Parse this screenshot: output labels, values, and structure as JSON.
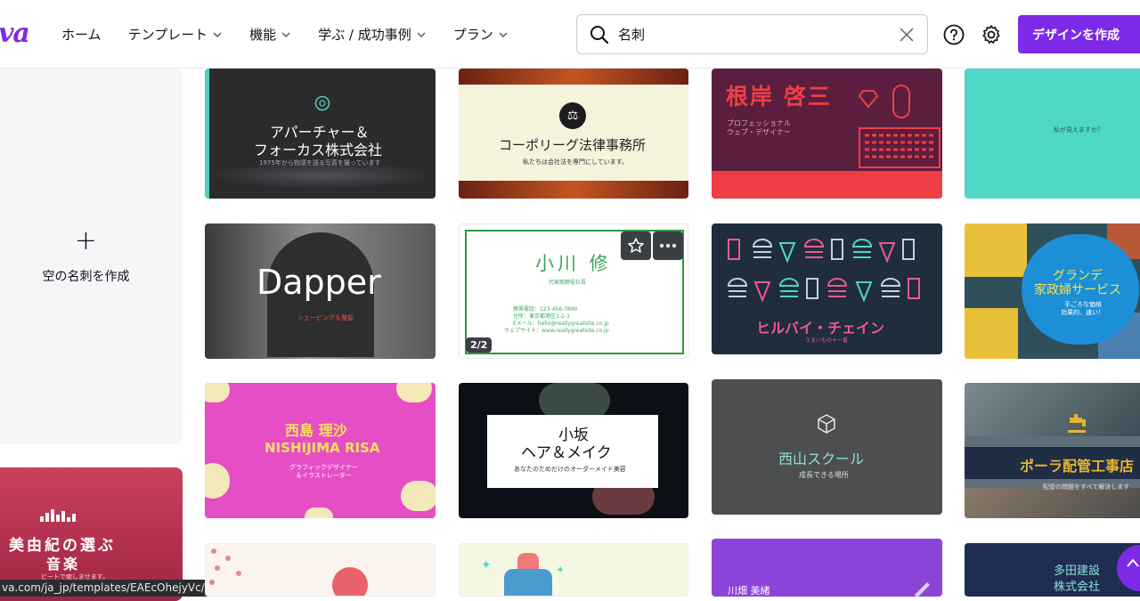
{
  "header": {
    "logo": "va",
    "nav": [
      {
        "label": "ホーム",
        "dropdown": false
      },
      {
        "label": "テンプレート",
        "dropdown": true
      },
      {
        "label": "機能",
        "dropdown": true
      },
      {
        "label": "学ぶ / 成功事例",
        "dropdown": true
      },
      {
        "label": "プラン",
        "dropdown": true
      }
    ],
    "search": {
      "value": "名刺",
      "icon": "search-icon",
      "clear_icon": "close-icon"
    },
    "help_icon": "help-circle-icon",
    "settings_icon": "gear-icon",
    "create_button": "デザインを作成"
  },
  "sidebar": {
    "blank_card_plus": "+",
    "blank_card_label": "空の名刺を作成",
    "music_card": {
      "line1": "美由紀の選ぶ",
      "line2": "音楽",
      "line3": "ビートで癒しませます。"
    }
  },
  "status_url": "va.com/ja_jp/templates/EAEcOhejyVc/",
  "templates": {
    "t1": {
      "line1": "アパーチャー＆",
      "line2": "フォーカス株式会社",
      "sub": "1975年から物語を語る写真を撮っています"
    },
    "t2": {
      "title": "コーポリーグ法律事務所",
      "sub": "私たちは会社法を専門にしています。"
    },
    "t3": {
      "name": "根岸 啓三",
      "role1": "プロフェッショナル",
      "role2": "ウェブ・デザイナー"
    },
    "t4": {
      "text": "私が見えますか？"
    },
    "t5": {
      "title": "Dapper",
      "sub": "シェービング＆整髪"
    },
    "t6": {
      "name": "小川 修",
      "role": "代表取締役社長",
      "line1": "携帯電話：123-456-7890",
      "line2": "住所：東京都港区1-2-3",
      "line3": "Eメール：hello@reallygreatsite.co.jp",
      "line4": "ウェブサイト：www.reallygreatsite.co.jp",
      "page": "2/2"
    },
    "t7": {
      "title": "ヒルバイ・チェイン",
      "sub": "うまいもの十一番"
    },
    "t8": {
      "line1": "グランデ",
      "line2": "家政婦サービス",
      "sub1": "手ごろな価格",
      "sub2": "効果的、速い！"
    },
    "t9": {
      "name": "西島 理沙",
      "romaji": "NISHIJIMA RISA",
      "role1": "グラフィックデザイナー",
      "role2": "＆イラストレーター"
    },
    "t10": {
      "line1": "小坂",
      "line2": "ヘア＆メイク",
      "sub": "あなたのためだけのオーダーメイド美容"
    },
    "t11": {
      "title": "西山スクール",
      "sub": "成長できる場所"
    },
    "t12": {
      "title": "ポーラ配管工事店",
      "sub": "配管の問題をすべて解決します"
    },
    "t15": {
      "name": "川畑 美緒"
    },
    "t16": {
      "line1": "多田建設",
      "line2": "株式会社"
    }
  },
  "colors": {
    "accent": "#7d2ae8"
  }
}
